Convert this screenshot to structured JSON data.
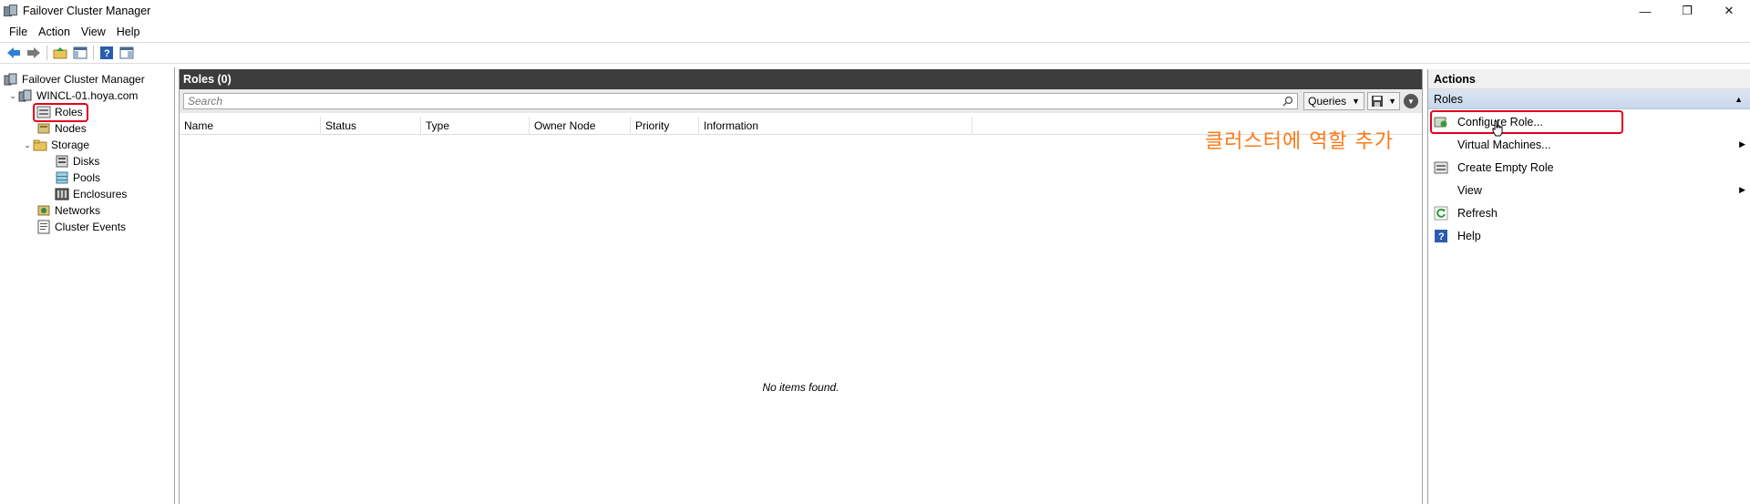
{
  "window": {
    "title": "Failover Cluster Manager",
    "minimize": "—",
    "restore": "❐",
    "close": "✕"
  },
  "menu": [
    "File",
    "Action",
    "View",
    "Help"
  ],
  "tree": {
    "root": "Failover Cluster Manager",
    "cluster": "WINCL-01.hoya.com",
    "roles": "Roles",
    "nodes": "Nodes",
    "storage": "Storage",
    "disks": "Disks",
    "pools": "Pools",
    "enclosures": "Enclosures",
    "networks": "Networks",
    "cluster_events": "Cluster Events"
  },
  "center": {
    "title": "Roles (0)",
    "search_placeholder": "Search",
    "queries_label": "Queries",
    "columns": [
      "Name",
      "Status",
      "Type",
      "Owner Node",
      "Priority",
      "Information"
    ],
    "empty_message": "No items found."
  },
  "actions": {
    "title": "Actions",
    "section": "Roles",
    "items": [
      {
        "label": "Configure Role...",
        "icon": "configure-role-icon"
      },
      {
        "label": "Virtual Machines...",
        "icon": "none"
      },
      {
        "label": "Create Empty Role",
        "icon": "create-role-icon"
      },
      {
        "label": "View",
        "icon": "none"
      },
      {
        "label": "Refresh",
        "icon": "refresh-icon"
      },
      {
        "label": "Help",
        "icon": "help-icon"
      }
    ]
  },
  "annotation": "클러스터에 역할 추가",
  "colors": {
    "highlight": "#e0001b",
    "annotation": "#ff7a1a",
    "header_bg": "#3c3c3c",
    "section_bg": "#c7d7ea"
  }
}
